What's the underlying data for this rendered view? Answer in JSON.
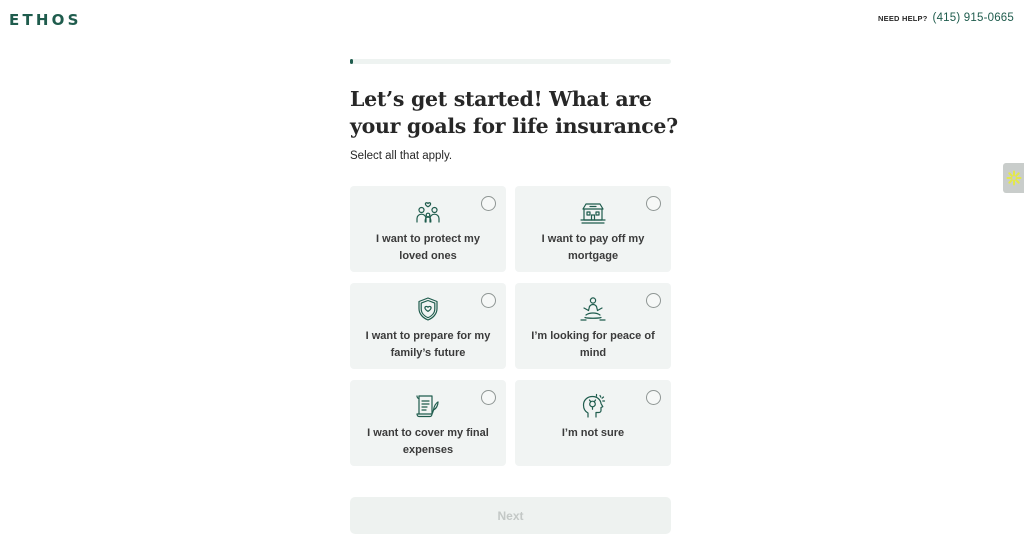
{
  "header": {
    "logo": "ETHOS",
    "help_label": "NEED HELP?",
    "phone": "(415) 915-0665"
  },
  "progress": {
    "value": 0.01
  },
  "question": {
    "title": "Let’s get started! What are your goals for life insurance?",
    "subtitle": "Select all that apply."
  },
  "options": [
    {
      "label": "I want to protect my loved ones",
      "icon": "family-icon",
      "selected": false
    },
    {
      "label": "I want to pay off my mortgage",
      "icon": "house-icon",
      "selected": false
    },
    {
      "label": "I want to prepare for my family’s future",
      "icon": "shield-heart-icon",
      "selected": false
    },
    {
      "label": "I’m looking for peace of mind",
      "icon": "meditation-icon",
      "selected": false
    },
    {
      "label": "I want to cover my final expenses",
      "icon": "document-quill-icon",
      "selected": false
    },
    {
      "label": "I’m not sure",
      "icon": "thinking-head-icon",
      "selected": false
    }
  ],
  "footer": {
    "next_label": "Next"
  },
  "colors": {
    "brand": "#1f5c4d",
    "card_bg": "#f1f4f3",
    "button_disabled_bg": "#eef2f0",
    "accent_yellow": "#e3e84a"
  },
  "side_widget": {
    "icon": "sparkle-icon"
  }
}
